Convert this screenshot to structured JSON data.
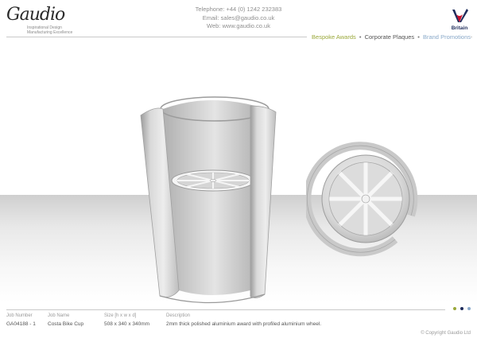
{
  "header": {
    "logo_text": "Gaudio",
    "logo_tagline_1": "Inspirational Design",
    "logo_tagline_2": "Manufacturing Excellence",
    "telephone": "Telephone: +44 (0) 1242 232383",
    "email": "Email: sales@gaudio.co.uk",
    "web": "Web: www.gaudio.co.uk",
    "brand_badge_label": "Britain"
  },
  "nav": {
    "items": [
      {
        "label": "Bespoke Awards",
        "color": "#9aa83a"
      },
      {
        "label": "Corporate Plaques",
        "color": "#555555"
      },
      {
        "label": "Brand Promotions",
        "color": "#8aa9c9"
      }
    ],
    "separator": "•"
  },
  "footer": {
    "job_number_label": "Job Number",
    "job_number": "GA04188 - 1",
    "job_name_label": "Job Name",
    "job_name": "Costa Bike Cup",
    "size_label": "Size [h x w x d]",
    "size": "508 x 340 x 340mm",
    "description_label": "Description",
    "description": "2mm thick polished aluminium award with profiled aluminium wheel.",
    "copyright": "© Copyright Gaudio Ltd",
    "dot_colors": [
      "#9aa83a",
      "#1f2d5c",
      "#8aa9c9"
    ]
  },
  "colors": {
    "metal_light": "#ececec",
    "metal_mid": "#c8c8c8",
    "metal_dark": "#9a9a9a"
  }
}
